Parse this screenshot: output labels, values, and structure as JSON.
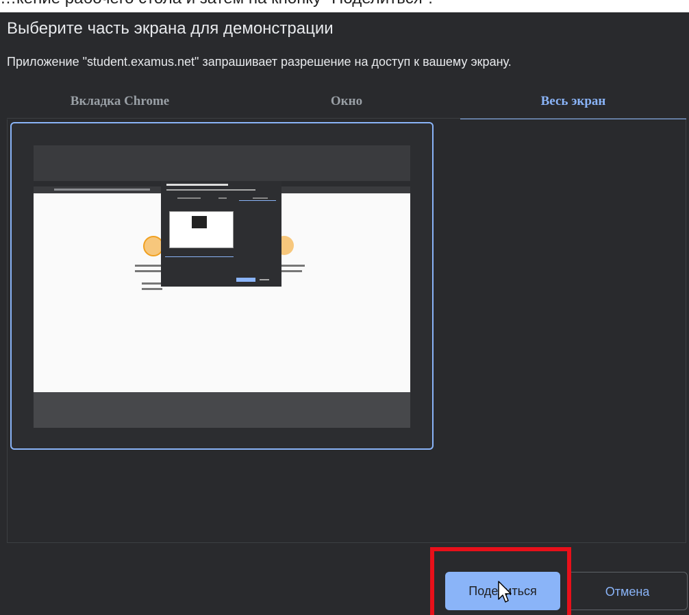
{
  "page_caption": "…кение рабочего стола и затем на кнопку \"Поделиться\".",
  "dialog": {
    "title": "Выберите часть экрана для демонстрации",
    "subtitle": "Приложение \"student.examus.net\" запрашивает разрешение на доступ к вашему экрану."
  },
  "tabs": [
    {
      "label": "Вкладка Chrome",
      "selected": false
    },
    {
      "label": "Окно",
      "selected": false
    },
    {
      "label": "Весь экран",
      "selected": true
    }
  ],
  "buttons": {
    "share_label": "Поделиться",
    "cancel_label": "Отмена"
  },
  "colors": {
    "accent": "#8ab4f8",
    "background": "#292a2d",
    "highlight": "#e8101a"
  }
}
